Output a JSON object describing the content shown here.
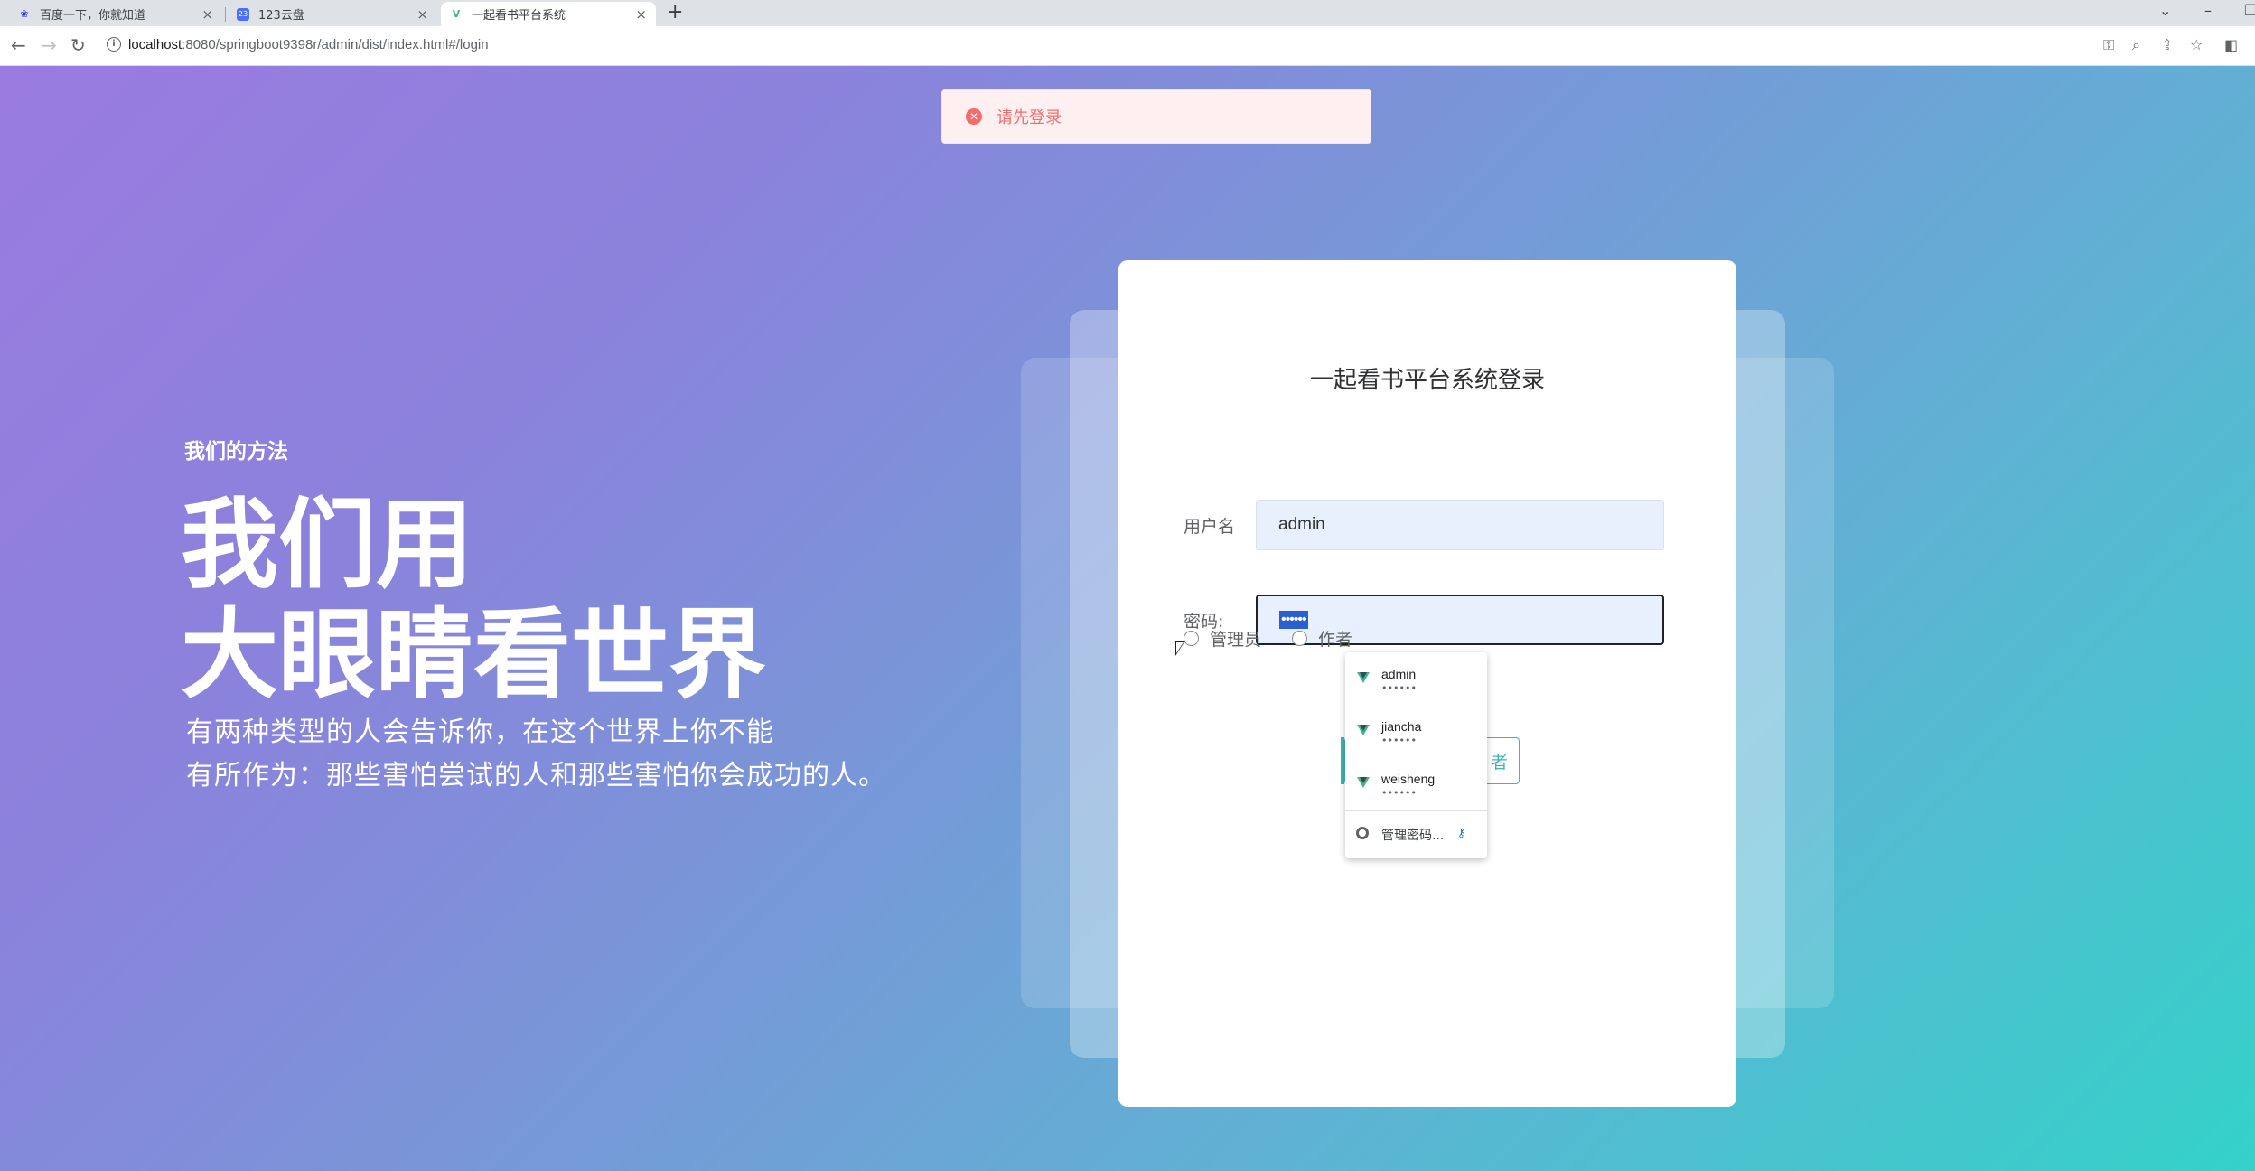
{
  "browser": {
    "tabs": [
      {
        "title": "百度一下，你就知道",
        "icon": "baidu-paw-icon",
        "active": false
      },
      {
        "title": "123云盘",
        "icon": "cloud-drive-icon",
        "active": false
      },
      {
        "title": "一起看书平台系统",
        "icon": "vue-logo-icon",
        "active": true
      }
    ],
    "url_host": "localhost",
    "url_rest": ":8080/springboot9398r/admin/dist/index.html#/login"
  },
  "toast": {
    "message": "请先登录",
    "color": "#f56c6c"
  },
  "hero": {
    "small": "我们的方法",
    "big_line1": "我们用",
    "big_line2": "大眼睛看世界",
    "desc_line1": "有两种类型的人会告诉你，在这个世界上你不能",
    "desc_line2": "有所作为：那些害怕尝试的人和那些害怕你会成功的人。"
  },
  "login": {
    "title": "一起看书平台系统登录",
    "username_label": "用户名",
    "username_value": "admin",
    "password_label": "密码:",
    "password_value": "••••••",
    "roles": [
      "管理员",
      "作者"
    ],
    "button_partial": "者",
    "accent": "#3eb6b3"
  },
  "autofill": {
    "items": [
      {
        "user": "admin",
        "masked": "••••••"
      },
      {
        "user": "jiancha",
        "masked": "••••••"
      },
      {
        "user": "weisheng",
        "masked": "••••••"
      }
    ],
    "manage_label": "管理密码..."
  },
  "background_colors": {
    "start": "#9a7be0",
    "end": "#34d2c9"
  }
}
